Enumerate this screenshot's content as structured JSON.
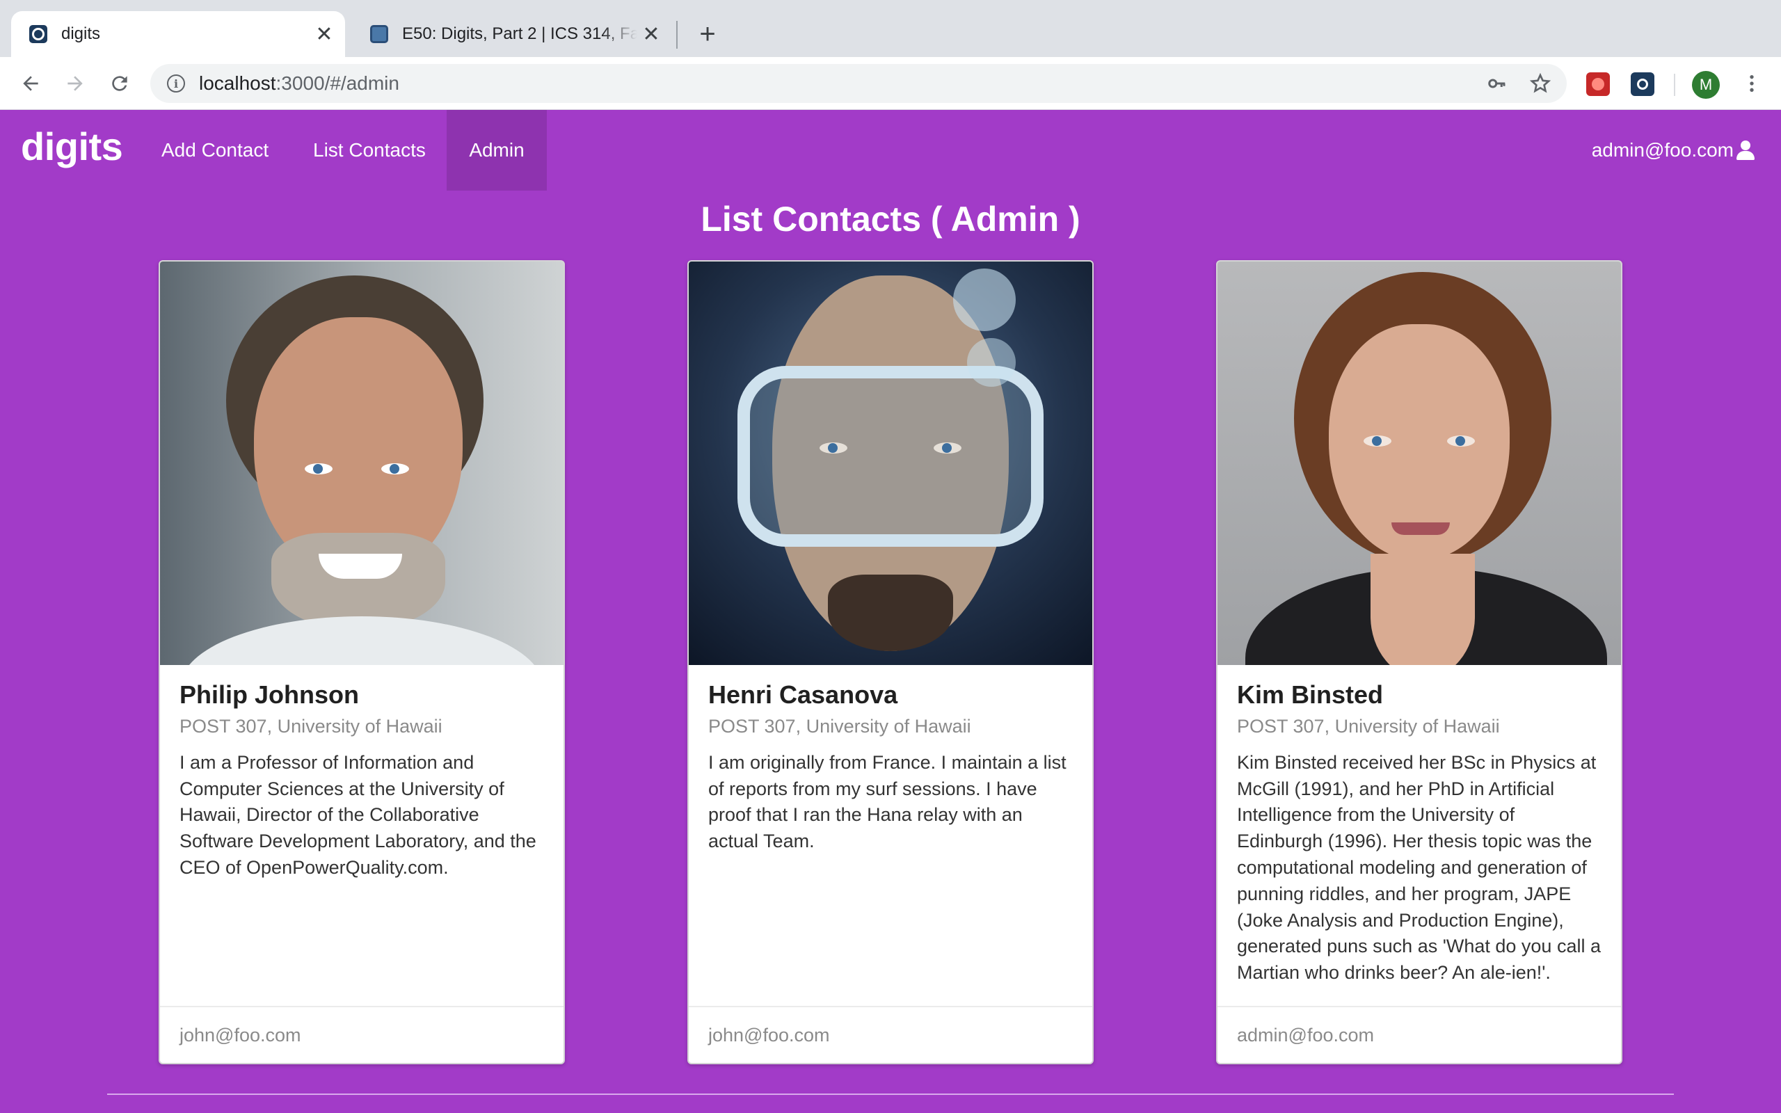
{
  "browser": {
    "tabs": [
      {
        "title": "digits",
        "active": true
      },
      {
        "title": "E50: Digits, Part 2 | ICS 314, Fall",
        "active": false
      }
    ],
    "new_tab_symbol": "+",
    "close_symbol": "✕",
    "url": {
      "host": "localhost",
      "rest": ":3000/#/admin"
    },
    "profile_initial": "M",
    "icons": [
      "back-icon",
      "forward-icon",
      "reload-icon",
      "info-icon",
      "key-icon",
      "star-icon",
      "menu-icon"
    ]
  },
  "navbar": {
    "brand": "digits",
    "items": [
      "Add Contact",
      "List Contacts",
      "Admin"
    ],
    "active_item": "Admin",
    "user": "admin@foo.com",
    "background_color": "#a23bc8"
  },
  "page": {
    "title": "List Contacts ( Admin )"
  },
  "contacts": [
    {
      "name": "Philip Johnson",
      "address": "POST 307, University of Hawaii",
      "description": "I am a Professor of Information and Computer Sciences at the University of Hawaii, Director of the Collaborative Software Development Laboratory, and the CEO of OpenPowerQuality.com.",
      "owner": "john@foo.com"
    },
    {
      "name": "Henri Casanova",
      "address": "POST 307, University of Hawaii",
      "description": "I am originally from France. I maintain a list of reports from my surf sessions. I have proof that I ran the Hana relay with an actual Team.",
      "owner": "john@foo.com"
    },
    {
      "name": "Kim Binsted",
      "address": "POST 307, University of Hawaii",
      "description": "Kim Binsted received her BSc in Physics at McGill (1991), and her PhD in Artificial Intelligence from the University of Edinburgh (1996). Her thesis topic was the computational modeling and generation of punning riddles, and her program, JAPE (Joke Analysis and Production Engine), generated puns such as 'What do you call a Martian who drinks beer? An ale-ien!'.",
      "owner": "admin@foo.com"
    }
  ]
}
